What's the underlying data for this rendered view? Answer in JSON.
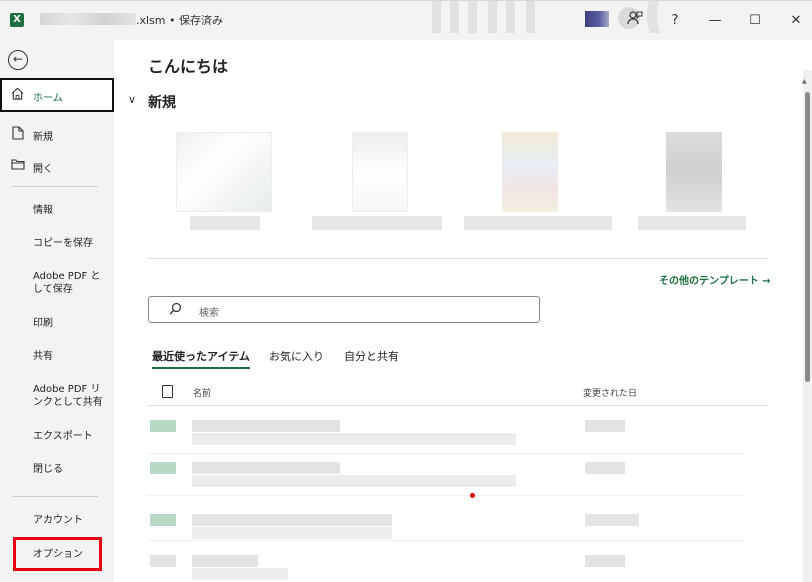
{
  "titlebar": {
    "app_icon_letter": "X",
    "file_suffix": ".xlsm",
    "separator": "•",
    "save_status": "保存済み",
    "help_glyph": "?",
    "minimize_glyph": "—",
    "maximize_glyph": "☐",
    "close_glyph": "✕"
  },
  "sidebar": {
    "back_glyph": "←",
    "home": {
      "label": "ホーム"
    },
    "new": {
      "label": "新規"
    },
    "open": {
      "label": "開く"
    },
    "items": [
      {
        "label": "情報"
      },
      {
        "label": "コピーを保存"
      },
      {
        "label": "Adobe PDF と して保存"
      },
      {
        "label": "印刷"
      },
      {
        "label": "共有"
      },
      {
        "label": "Adobe PDF リ ンクとして共有"
      },
      {
        "label": "エクスポート"
      },
      {
        "label": "閉じる"
      }
    ],
    "account": {
      "label": "アカウント"
    },
    "options": {
      "label": "オプション"
    }
  },
  "main": {
    "greeting": "こんにちは",
    "new_toggle_glyph": "∨",
    "new_title": "新規",
    "more_templates": "その他のテンプレート →",
    "search": {
      "placeholder": "検索"
    },
    "tabs": [
      {
        "label": "最近使ったアイテム",
        "active": true
      },
      {
        "label": "お気に入り",
        "active": false
      },
      {
        "label": "自分と共有",
        "active": false
      }
    ],
    "columns": {
      "name": "名前",
      "modified": "変更された日"
    }
  },
  "colors": {
    "accent": "#1d6f42",
    "highlight_box": "#e60012"
  }
}
